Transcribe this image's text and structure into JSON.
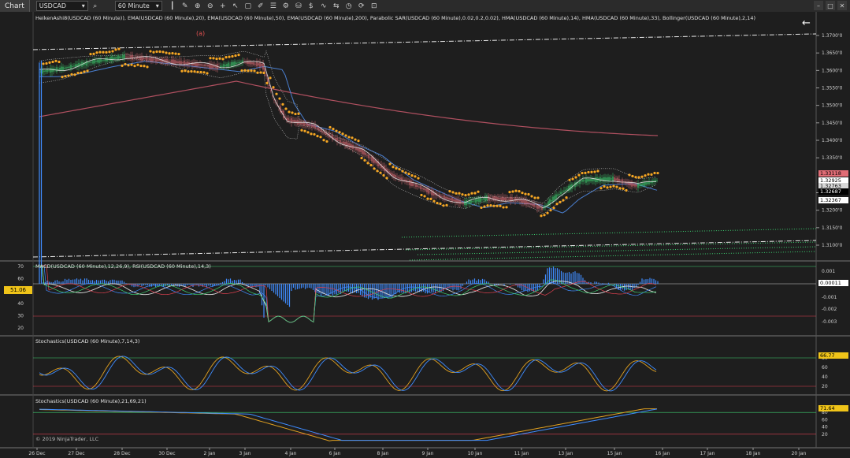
{
  "toolbar": {
    "chart_label": "Chart",
    "instrument": "USDCAD",
    "timeframe": "60 Minute",
    "tools": [
      "search-icon",
      "bar-chart-icon",
      "pencil-icon",
      "zoom-in-icon",
      "zoom-out-icon",
      "crosshair-icon",
      "pointer-icon",
      "data-box-icon",
      "drawing-tool-icon",
      "template-icon",
      "properties-icon",
      "strategy-icon",
      "chart-trader-icon",
      "indicators-icon",
      "scroll-icon",
      "timeframe-icon",
      "sync-icon",
      "lock-icon"
    ]
  },
  "panels": {
    "price": {
      "label": "HeikenAshi8(USDCAD (60 Minute)), EMA(USDCAD (60 Minute),20), EMA(USDCAD (60 Minute),50), EMA(USDCAD (60 Minute),200), Parabolic SAR(USDCAD (60 Minute),0.02,0.2,0.02), HMA(USDCAD (60 Minute),14), HMA(USDCAD (60 Minute),33), Bollinger(USDCAD (60 Minute),2,14)",
      "annotation": "(a)",
      "axis_ticks": [
        "1.3700'0",
        "1.3650'0",
        "1.3600'0",
        "1.3550'0",
        "1.3500'0",
        "1.3450'0",
        "1.3400'0",
        "1.3350'0",
        "1.3250'0",
        "1.3200'0",
        "1.3150'0",
        "1.3100'0"
      ],
      "badges": [
        {
          "text": "1.33118",
          "bg": "#e06c75",
          "fg": "#000"
        },
        {
          "text": "1.32925",
          "bg": "#ffffff",
          "fg": "#000"
        },
        {
          "text": "1.32763",
          "bg": "#d8d8d8",
          "fg": "#000"
        },
        {
          "text": "1.32687",
          "bg": "#000000",
          "fg": "#fff"
        },
        {
          "text": "1.32367",
          "bg": "#ffffff",
          "fg": "#000"
        }
      ],
      "back_icon": "back-arrow-icon"
    },
    "macd_rsi": {
      "label": "MACD(USDCAD (60 Minute),12,26,9), RSI(USDCAD (60 Minute),14,3)",
      "left_ticks": [
        "70",
        "60",
        "50",
        "40",
        "30",
        "20"
      ],
      "right_ticks": [
        "0.001",
        "-0.001",
        "-0.002",
        "-0.003"
      ],
      "left_badge": "51.06",
      "right_badge": "0.00011"
    },
    "stoch1": {
      "label": "Stochastics(USDCAD (60 Minute),7,14,3)",
      "ticks": [
        "80",
        "60",
        "40",
        "20"
      ],
      "badge": "66.77"
    },
    "stoch2": {
      "label": "Stochastics(USDCAD (60 Minute),21,69,21)",
      "ticks": [
        "80",
        "60",
        "40",
        "20"
      ],
      "badge": "71.64",
      "copyright": "© 2019 NinjaTrader, LLC"
    }
  },
  "time_axis": [
    "26 Dec",
    "27 Dec",
    "28 Dec",
    "30 Dec",
    "2 Jan",
    "3 Jan",
    "4 Jan",
    "6 Jan",
    "8 Jan",
    "9 Jan",
    "10 Jan",
    "11 Jan",
    "13 Jan",
    "15 Jan",
    "16 Jan",
    "17 Jan",
    "18 Jan",
    "20 Jan"
  ],
  "colors": {
    "background": "#1e1e1e",
    "heiken_up": "#3cd070",
    "heiken_down": "#e06c75",
    "sar": "#f5a623",
    "ema200": "#b05060",
    "ema50": "#4a7fd0",
    "bollinger": "#cfcfcf",
    "macd_hist": "#3f8cff",
    "stoch_k": "#e0a020",
    "stoch_d": "#3f8cff"
  }
}
